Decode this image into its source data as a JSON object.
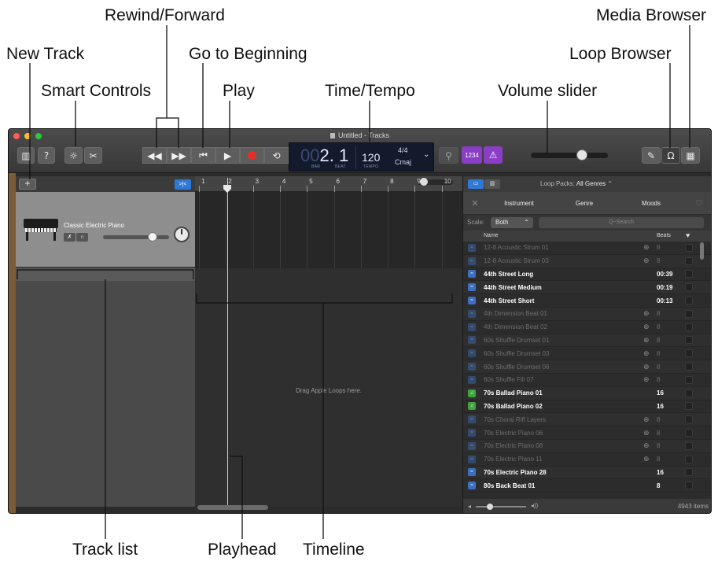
{
  "callouts": {
    "rewind_forward": "Rewind/Forward",
    "media_browser": "Media Browser",
    "new_track": "New Track",
    "go_to_beginning": "Go to Beginning",
    "loop_browser": "Loop Browser",
    "smart_controls": "Smart Controls",
    "play": "Play",
    "time_tempo": "Time/Tempo",
    "volume_slider": "Volume slider",
    "track_list": "Track list",
    "playhead": "Playhead",
    "timeline": "Timeline"
  },
  "window": {
    "title": "Untitled - Tracks"
  },
  "lcd": {
    "position": "2. 1",
    "position_dim": "00",
    "bar_label": "BAR",
    "beat_label": "BEAT",
    "tempo": "120",
    "tempo_label": "TEMPO",
    "signature": "4/4",
    "key": "Cmaj"
  },
  "toolbar": {
    "count_in": "1234"
  },
  "track": {
    "name": "Classic Electric Piano",
    "volume_fraction": 0.75
  },
  "ruler": {
    "bars": [
      "1",
      "2",
      "3",
      "4",
      "5",
      "6",
      "7",
      "8",
      "9",
      "10"
    ]
  },
  "timeline": {
    "drop_hint": "Drag Apple Loops here."
  },
  "loop_browser": {
    "loop_packs_label": "Loop Packs:",
    "loop_packs_value": "All Genres",
    "tabs": [
      "Instrument",
      "Genre",
      "Moods"
    ],
    "scale_label": "Scale:",
    "scale_value": "Both",
    "search_placeholder": "Q~Search",
    "col_name": "Name",
    "col_beats": "Beats",
    "item_count": "4943 items",
    "rows": [
      {
        "name": "12-8 Acoustic Strum 01",
        "beats": "8",
        "download": true,
        "type": "audio"
      },
      {
        "name": "12-8 Acoustic Strum 03",
        "beats": "8",
        "download": true,
        "type": "audio"
      },
      {
        "name": "44th Street Long",
        "beats": "00:39",
        "download": false,
        "type": "audio"
      },
      {
        "name": "44th Street Medium",
        "beats": "00:19",
        "download": false,
        "type": "audio"
      },
      {
        "name": "44th Street Short",
        "beats": "00:13",
        "download": false,
        "type": "audio"
      },
      {
        "name": "4th Dimension Beat 01",
        "beats": "8",
        "download": true,
        "type": "audio"
      },
      {
        "name": "4th Dimension Beat 02",
        "beats": "8",
        "download": true,
        "type": "audio"
      },
      {
        "name": "60s Shuffle Drumset 01",
        "beats": "8",
        "download": true,
        "type": "audio"
      },
      {
        "name": "60s Shuffle Drumset 03",
        "beats": "8",
        "download": true,
        "type": "audio"
      },
      {
        "name": "60s Shuffle Drumset 06",
        "beats": "8",
        "download": true,
        "type": "audio"
      },
      {
        "name": "60s Shuffle Fill 07",
        "beats": "8",
        "download": true,
        "type": "audio"
      },
      {
        "name": "70s Ballad Piano 01",
        "beats": "16",
        "download": false,
        "type": "midi"
      },
      {
        "name": "70s Ballad Piano 02",
        "beats": "16",
        "download": false,
        "type": "midi"
      },
      {
        "name": "70s Choral Riff Layers",
        "beats": "8",
        "download": true,
        "type": "audio"
      },
      {
        "name": "70s Electric Piano 06",
        "beats": "8",
        "download": true,
        "type": "audio"
      },
      {
        "name": "70s Electric Piano 08",
        "beats": "8",
        "download": true,
        "type": "audio"
      },
      {
        "name": "70s Electric Piano 11",
        "beats": "8",
        "download": true,
        "type": "audio"
      },
      {
        "name": "70s Electric Piano 28",
        "beats": "16",
        "download": false,
        "type": "audio"
      },
      {
        "name": "80s Back Beat 01",
        "beats": "8",
        "download": false,
        "type": "audio"
      }
    ]
  },
  "colors": {
    "purple_accent": "#8a3ec6",
    "record_red": "#e0302a",
    "audio_loop_blue": "#3d6fc0",
    "midi_loop_green": "#3fa33f",
    "lcd_bg": "#131a2b"
  }
}
